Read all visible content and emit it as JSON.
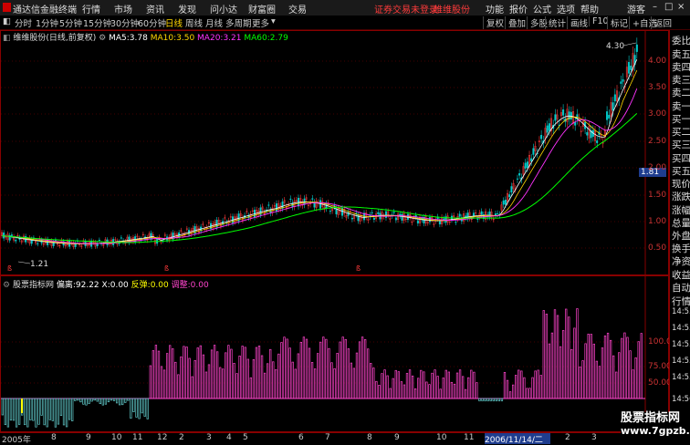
{
  "menubar": {
    "app_name": "通达信金融终端",
    "items": [
      "行情",
      "市场",
      "资讯",
      "发现",
      "问小达",
      "财富圈",
      "交易"
    ],
    "notice": "证券交易未登录",
    "stock": "维维股份",
    "right_items": [
      "功能",
      "报价",
      "公式",
      "选项",
      "帮助"
    ],
    "guest": "游客"
  },
  "toolbar": {
    "periods": [
      "分时",
      "1分钟",
      "5分钟",
      "15分钟",
      "30分钟",
      "60分钟",
      "日线",
      "周线",
      "月线",
      "多周期",
      "更多"
    ],
    "active_period": "日线",
    "right_tools": [
      "复权",
      "叠加",
      "多股",
      "统计",
      "画线",
      "F10",
      "标记",
      "+自选",
      "返回"
    ]
  },
  "chart_info": {
    "title": "维维股份(日线,前复权)",
    "ma5_label": "MA5:",
    "ma5": "3.78",
    "ma10_label": "MA10:",
    "ma10": "3.50",
    "ma20_label": "MA20:",
    "ma20": "3.21",
    "ma60_label": "MA60:",
    "ma60": "2.79"
  },
  "indicator_info": {
    "title": "股票指标网",
    "pianli_label": "偏离:",
    "pianli": "92.22",
    "x_label": "X:",
    "x": "0.00",
    "fantan_label": "反弹:",
    "fantan": "0.00",
    "tiaozheng_label": "调整:",
    "tiaozheng": "0.00"
  },
  "annotations": {
    "high_price": "4.30",
    "low_price": "1.21",
    "current_price": "1.81"
  },
  "price_axis": [
    "4.00",
    "3.50",
    "3.00",
    "2.50",
    "2.00",
    "1.50",
    "1.00",
    "0.50"
  ],
  "volume_axis": [
    "100.0",
    "75.00",
    "50.00"
  ],
  "date_axis": {
    "labels": [
      "2005年",
      "8",
      "9",
      "10",
      "11",
      "12",
      "2",
      "3",
      "4",
      "5",
      "6",
      "7",
      "8",
      "9",
      "10",
      "11",
      "12",
      "2",
      "3"
    ],
    "highlight": "2006/11/14/二"
  },
  "right_panel": [
    "委比",
    "卖五",
    "卖四",
    "卖三",
    "卖二",
    "卖一",
    "买一",
    "买二",
    "买三",
    "买四",
    "买五",
    "现价",
    "涨跌",
    "涨幅",
    "总量",
    "外盘",
    "换手",
    "净资",
    "收益",
    "自动",
    "行情",
    "14:55",
    "14:55",
    "14:55",
    "14:55",
    "14:55",
    "14:56",
    "14:56",
    "14:56"
  ],
  "watermark": {
    "line1": "股票指标网",
    "line2": "www.7gpzb.com"
  },
  "colors": {
    "up": "#ff3b3b",
    "ma5": "#ffffff",
    "ma10": "#ffd700",
    "ma20": "#ff33ff",
    "ma60": "#00ff00",
    "histogram_pos": "#ff44cc",
    "histogram_neg": "#5fc6c6"
  }
}
